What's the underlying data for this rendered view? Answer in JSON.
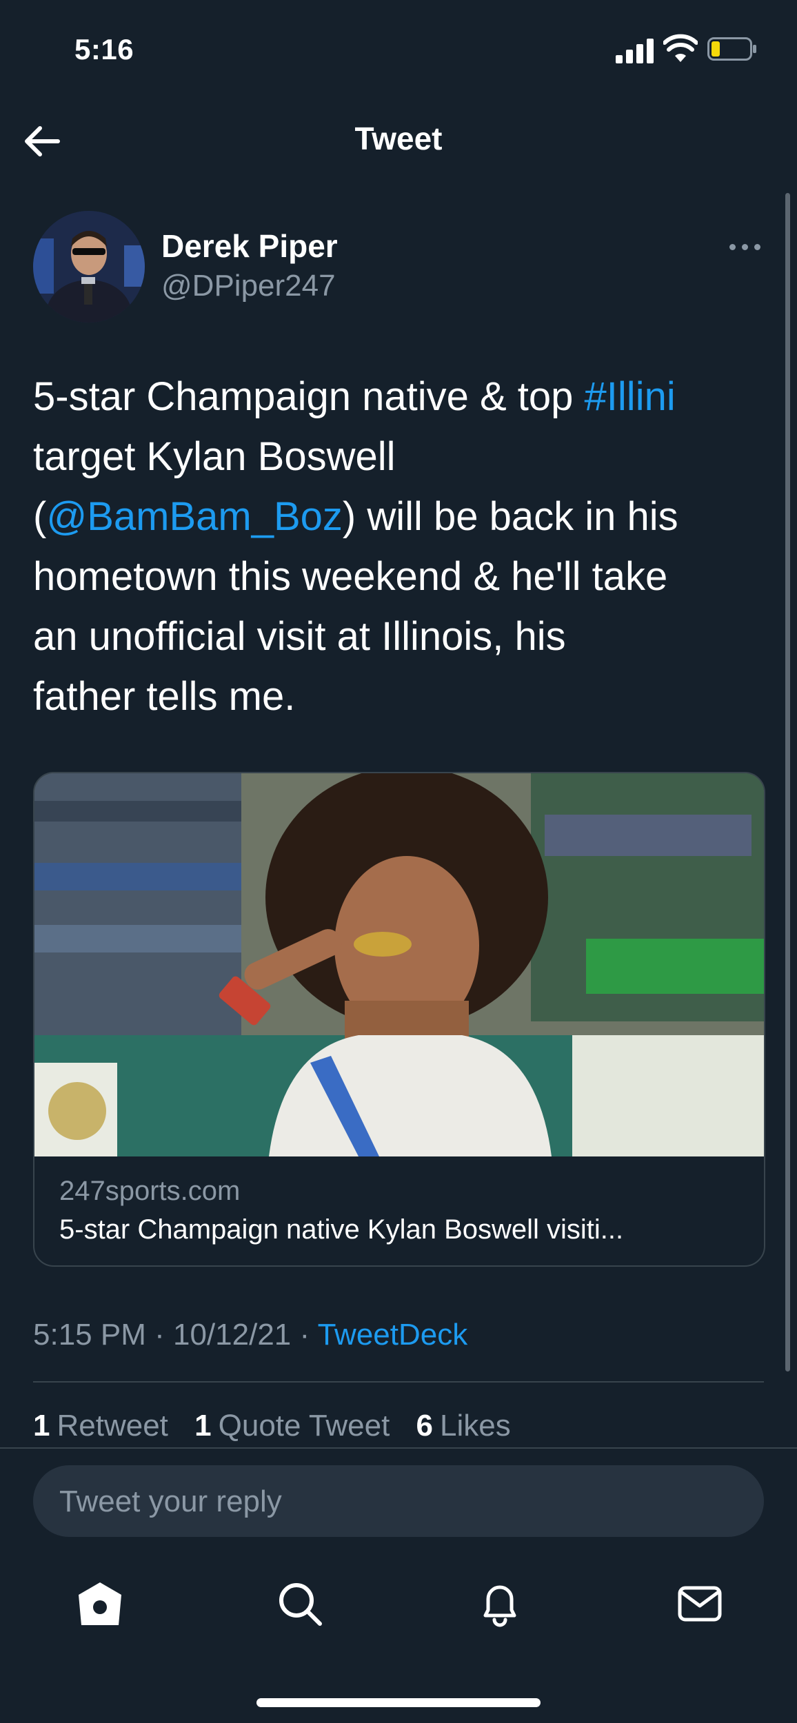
{
  "status_bar": {
    "time": "5:16"
  },
  "nav": {
    "title": "Tweet"
  },
  "tweet": {
    "author_name": "Derek Piper",
    "author_handle": "@DPiper247",
    "text_parts": {
      "p1": "5-star Champaign native & top ",
      "hashtag": "#Illini",
      "p2": "\ntarget Kylan Boswell\n(",
      "mention": "@BamBam_Boz",
      "p3": ") will be back in his\nhometown this weekend & he'll take\nan unofficial visit at Illinois, his\nfather tells me."
    },
    "card": {
      "domain": "247sports.com",
      "title": "5-star Champaign native Kylan Boswell visiti..."
    },
    "meta": {
      "time": "5:15 PM",
      "separator": "·",
      "date": "10/12/21",
      "source": "TweetDeck"
    },
    "stats": {
      "retweets_count": "1",
      "retweets_label": "Retweet",
      "quotes_count": "1",
      "quotes_label": "Quote Tweet",
      "likes_count": "6",
      "likes_label": "Likes"
    }
  },
  "reply": {
    "placeholder": "Tweet your reply"
  },
  "tabs": [
    "home-icon",
    "search-icon",
    "bell-icon",
    "mail-icon"
  ],
  "colors": {
    "background": "#15202b",
    "accent": "#1d9bf0",
    "muted": "#8b98a5",
    "border": "#38444d",
    "battery_low": "#f5d90a"
  }
}
